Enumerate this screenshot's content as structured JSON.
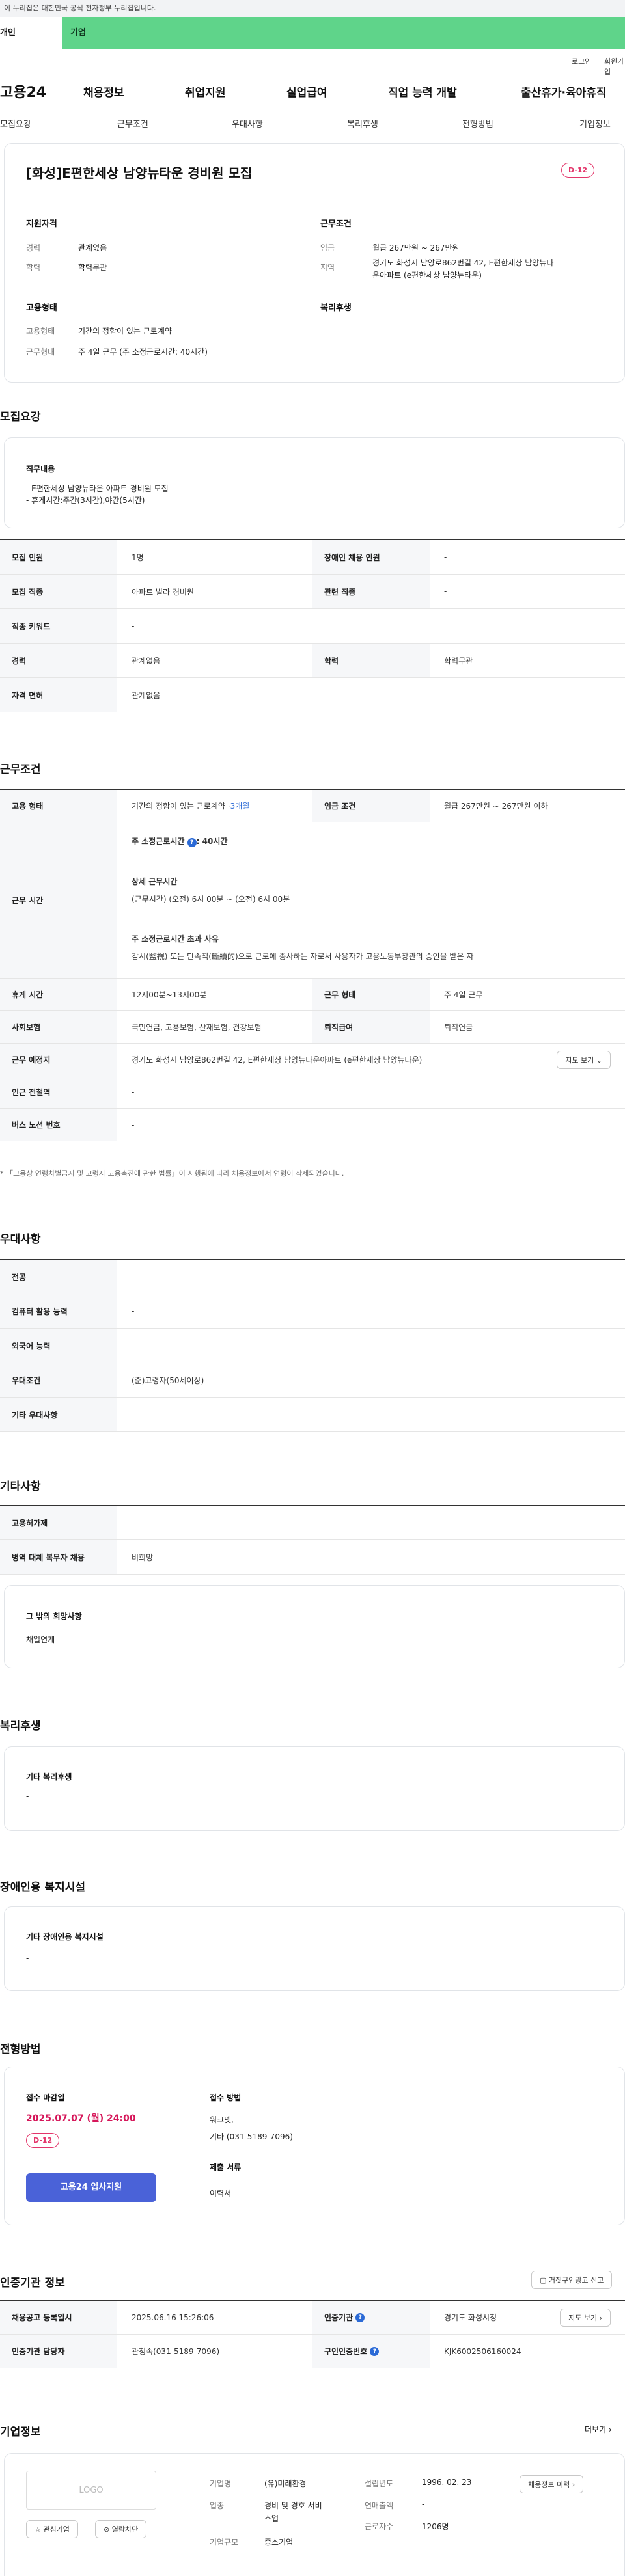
{
  "gov_banner": "이 누리집은 대한민국 공식 전자정부 누리집입니다.",
  "user_types": [
    "개인",
    "기업"
  ],
  "util": {
    "login": "로그인",
    "signup": "회원가입"
  },
  "gnb": {
    "logo": "고용24",
    "items": [
      "채용정보",
      "취업지원",
      "실업급여",
      "직업 능력 개발",
      "출산휴가·육아휴직"
    ]
  },
  "tabs": [
    "모집요강",
    "근무조건",
    "우대사항",
    "복리후생",
    "전형방법",
    "기업정보"
  ],
  "summary": {
    "title": "[화성]E편한세상 남양뉴타운 경비원 모집",
    "dday": "D-12",
    "qual_head": "지원자격",
    "qual": [
      {
        "k": "경력",
        "v": "관계없음"
      },
      {
        "k": "학력",
        "v": "학력무관"
      }
    ],
    "cond_head": "근무조건",
    "cond": [
      {
        "k": "임금",
        "v": "월급 267만원 ~ 267만원"
      },
      {
        "k": "지역",
        "v": "경기도 화성시 남양로862번길 42, E편한세상 남양뉴타",
        "v2": "운아파트 (e편한세상 남양뉴타운)"
      }
    ],
    "emp_head": "고용형태",
    "emp": [
      {
        "k": "고용형태",
        "v": "기간의 정함이 있는 근로계약"
      },
      {
        "k": "근무형태",
        "v": "주 4일 근무 (주 소정근로시간: 40시간)"
      }
    ],
    "welfare_head": "복리후생"
  },
  "recruit": {
    "head": "모집요강",
    "duty_head": "직무내용",
    "duty1": "- E편한세상 남양뉴타운 아파트 경비원 모집",
    "duty2": "- 휴게시간:주간(3시간),야간(5시간)",
    "rows": [
      [
        "모집 인원",
        "1명",
        "장애인 채용 인원",
        "-"
      ],
      [
        "모집 직종",
        "아파트 빌라 경비원",
        "관련 직종",
        "-"
      ],
      [
        "직종 키워드",
        "-"
      ],
      [
        "경력",
        "관계없음",
        "학력",
        "학력무관"
      ],
      [
        "자격 면허",
        "관계없음"
      ]
    ]
  },
  "work": {
    "head": "근무조건",
    "type_label": "고용 형태",
    "type_val": "기간의 정함이 있는 근로계약 · ",
    "type_months": "3개월",
    "wage_label": "임금 조건",
    "wage_val": "월급 267만원 ~ 267만원 이하",
    "hours_label": "근무 시간",
    "hours_a": "주 소정근로시간 ",
    "hours_a_val": ": 40시간",
    "hours_b": "상세 근무시간",
    "hours_b_val": "(근무시간) (오전) 6시 00분 ~ (오전) 6시 00분",
    "hours_c": "주 소정근로시간 초과 사유",
    "hours_c_val": "감시(監視) 또는 단속적(斷續的)으로 근로에 종사하는 자로서 사용자가 고용노동부장관의 승인을 받은 자",
    "rows": [
      [
        "휴게 시간",
        "12시00분~13시00분",
        "근무 형태",
        "주 4일 근무"
      ],
      [
        "사회보험",
        "국민연금, 고용보험, 산재보험, 건강보험",
        "퇴직급여",
        "퇴직연금"
      ]
    ],
    "place_label": "근무 예정지",
    "place_val": "경기도 화성시 남양로862번길 42, E편한세상 남양뉴타운아파트 (e편한세상 남양뉴타운)",
    "map_btn": "지도 보기",
    "rows2": [
      [
        "인근 전철역",
        "-"
      ],
      [
        "버스 노선 번호",
        "-"
      ]
    ],
    "notice": "* 「고용상 연령차별금지 및 고령자 고용촉진에 관한 법률」이 시행됨에 따라 채용정보에서 연령이 삭제되었습니다."
  },
  "pref": {
    "head": "우대사항",
    "rows": [
      [
        "전공",
        "-"
      ],
      [
        "컴퓨터 활용 능력",
        "-"
      ],
      [
        "외국어 능력",
        "-"
      ],
      [
        "우대조건",
        "(준)고령자(50세이상)"
      ],
      [
        "기타 우대사항",
        "-"
      ]
    ]
  },
  "etc": {
    "head": "기타사항",
    "rows": [
      [
        "고용허가제",
        "-"
      ],
      [
        "병역 대체 복무자 채용",
        "비희망"
      ]
    ],
    "wish_head": "그 밖의 희망사항",
    "wish_val": "채일연계"
  },
  "welfare": {
    "head": "복리후생",
    "sub": "기타 복리후생",
    "val": "-"
  },
  "disab": {
    "head": "장애인용 복지시설",
    "sub": "기타 장애인용 복지시설",
    "val": "-"
  },
  "screen": {
    "head": "전형방법",
    "deadline_head": "접수 마감일",
    "deadline": "2025.07.07 (월) 24:00",
    "dday": "D-12",
    "apply_btn": "고용24 입사지원",
    "method_head": "접수 방법",
    "method1": "워크넷,",
    "method2": "기타 (031-5189-7096)",
    "docs_head": "제출 서류",
    "docs_val": "이력서"
  },
  "cert": {
    "head": "인증기관 정보",
    "report_btn": "거짓구인광고 신고",
    "rows": [
      [
        "채용공고 등록일시",
        "2025.06.16 15:26:06",
        "인증기관",
        "경기도 화성시청"
      ],
      [
        "인증기관 담당자",
        "관청속(031-5189-7096)",
        "구인인증번호",
        "KJK6002506160024"
      ]
    ],
    "map_btn": "지도 보기"
  },
  "company": {
    "head": "기업정보",
    "more": "더보기",
    "logo": "LOGO",
    "fav_btn": "관심기업",
    "block_btn": "열람차단",
    "f": [
      [
        "기업명",
        "(유)미래환경"
      ],
      [
        "업종",
        "경비 및 경호 서비",
        "스업"
      ],
      [
        "기업규모",
        "중소기업"
      ]
    ],
    "g": [
      [
        "설립년도",
        "1996. 02. 23"
      ],
      [
        "연매출액",
        "-"
      ],
      [
        "근로자수",
        "1206명"
      ]
    ],
    "hire_btn": "채용정보 이력"
  }
}
